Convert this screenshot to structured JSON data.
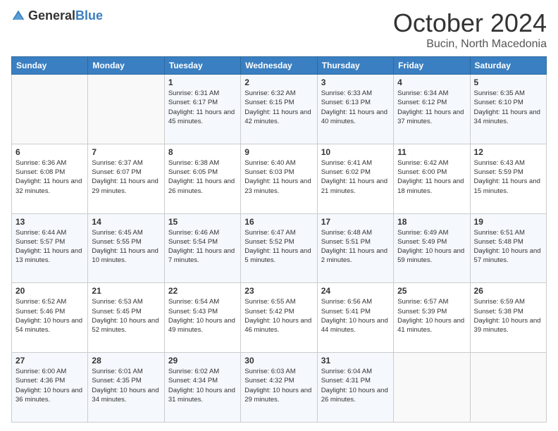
{
  "logo": {
    "general": "General",
    "blue": "Blue"
  },
  "header": {
    "month": "October 2024",
    "location": "Bucin, North Macedonia"
  },
  "weekdays": [
    "Sunday",
    "Monday",
    "Tuesday",
    "Wednesday",
    "Thursday",
    "Friday",
    "Saturday"
  ],
  "weeks": [
    [
      {
        "day": "",
        "sunrise": "",
        "sunset": "",
        "daylight": ""
      },
      {
        "day": "",
        "sunrise": "",
        "sunset": "",
        "daylight": ""
      },
      {
        "day": "1",
        "sunrise": "Sunrise: 6:31 AM",
        "sunset": "Sunset: 6:17 PM",
        "daylight": "Daylight: 11 hours and 45 minutes."
      },
      {
        "day": "2",
        "sunrise": "Sunrise: 6:32 AM",
        "sunset": "Sunset: 6:15 PM",
        "daylight": "Daylight: 11 hours and 42 minutes."
      },
      {
        "day": "3",
        "sunrise": "Sunrise: 6:33 AM",
        "sunset": "Sunset: 6:13 PM",
        "daylight": "Daylight: 11 hours and 40 minutes."
      },
      {
        "day": "4",
        "sunrise": "Sunrise: 6:34 AM",
        "sunset": "Sunset: 6:12 PM",
        "daylight": "Daylight: 11 hours and 37 minutes."
      },
      {
        "day": "5",
        "sunrise": "Sunrise: 6:35 AM",
        "sunset": "Sunset: 6:10 PM",
        "daylight": "Daylight: 11 hours and 34 minutes."
      }
    ],
    [
      {
        "day": "6",
        "sunrise": "Sunrise: 6:36 AM",
        "sunset": "Sunset: 6:08 PM",
        "daylight": "Daylight: 11 hours and 32 minutes."
      },
      {
        "day": "7",
        "sunrise": "Sunrise: 6:37 AM",
        "sunset": "Sunset: 6:07 PM",
        "daylight": "Daylight: 11 hours and 29 minutes."
      },
      {
        "day": "8",
        "sunrise": "Sunrise: 6:38 AM",
        "sunset": "Sunset: 6:05 PM",
        "daylight": "Daylight: 11 hours and 26 minutes."
      },
      {
        "day": "9",
        "sunrise": "Sunrise: 6:40 AM",
        "sunset": "Sunset: 6:03 PM",
        "daylight": "Daylight: 11 hours and 23 minutes."
      },
      {
        "day": "10",
        "sunrise": "Sunrise: 6:41 AM",
        "sunset": "Sunset: 6:02 PM",
        "daylight": "Daylight: 11 hours and 21 minutes."
      },
      {
        "day": "11",
        "sunrise": "Sunrise: 6:42 AM",
        "sunset": "Sunset: 6:00 PM",
        "daylight": "Daylight: 11 hours and 18 minutes."
      },
      {
        "day": "12",
        "sunrise": "Sunrise: 6:43 AM",
        "sunset": "Sunset: 5:59 PM",
        "daylight": "Daylight: 11 hours and 15 minutes."
      }
    ],
    [
      {
        "day": "13",
        "sunrise": "Sunrise: 6:44 AM",
        "sunset": "Sunset: 5:57 PM",
        "daylight": "Daylight: 11 hours and 13 minutes."
      },
      {
        "day": "14",
        "sunrise": "Sunrise: 6:45 AM",
        "sunset": "Sunset: 5:55 PM",
        "daylight": "Daylight: 11 hours and 10 minutes."
      },
      {
        "day": "15",
        "sunrise": "Sunrise: 6:46 AM",
        "sunset": "Sunset: 5:54 PM",
        "daylight": "Daylight: 11 hours and 7 minutes."
      },
      {
        "day": "16",
        "sunrise": "Sunrise: 6:47 AM",
        "sunset": "Sunset: 5:52 PM",
        "daylight": "Daylight: 11 hours and 5 minutes."
      },
      {
        "day": "17",
        "sunrise": "Sunrise: 6:48 AM",
        "sunset": "Sunset: 5:51 PM",
        "daylight": "Daylight: 11 hours and 2 minutes."
      },
      {
        "day": "18",
        "sunrise": "Sunrise: 6:49 AM",
        "sunset": "Sunset: 5:49 PM",
        "daylight": "Daylight: 10 hours and 59 minutes."
      },
      {
        "day": "19",
        "sunrise": "Sunrise: 6:51 AM",
        "sunset": "Sunset: 5:48 PM",
        "daylight": "Daylight: 10 hours and 57 minutes."
      }
    ],
    [
      {
        "day": "20",
        "sunrise": "Sunrise: 6:52 AM",
        "sunset": "Sunset: 5:46 PM",
        "daylight": "Daylight: 10 hours and 54 minutes."
      },
      {
        "day": "21",
        "sunrise": "Sunrise: 6:53 AM",
        "sunset": "Sunset: 5:45 PM",
        "daylight": "Daylight: 10 hours and 52 minutes."
      },
      {
        "day": "22",
        "sunrise": "Sunrise: 6:54 AM",
        "sunset": "Sunset: 5:43 PM",
        "daylight": "Daylight: 10 hours and 49 minutes."
      },
      {
        "day": "23",
        "sunrise": "Sunrise: 6:55 AM",
        "sunset": "Sunset: 5:42 PM",
        "daylight": "Daylight: 10 hours and 46 minutes."
      },
      {
        "day": "24",
        "sunrise": "Sunrise: 6:56 AM",
        "sunset": "Sunset: 5:41 PM",
        "daylight": "Daylight: 10 hours and 44 minutes."
      },
      {
        "day": "25",
        "sunrise": "Sunrise: 6:57 AM",
        "sunset": "Sunset: 5:39 PM",
        "daylight": "Daylight: 10 hours and 41 minutes."
      },
      {
        "day": "26",
        "sunrise": "Sunrise: 6:59 AM",
        "sunset": "Sunset: 5:38 PM",
        "daylight": "Daylight: 10 hours and 39 minutes."
      }
    ],
    [
      {
        "day": "27",
        "sunrise": "Sunrise: 6:00 AM",
        "sunset": "Sunset: 4:36 PM",
        "daylight": "Daylight: 10 hours and 36 minutes."
      },
      {
        "day": "28",
        "sunrise": "Sunrise: 6:01 AM",
        "sunset": "Sunset: 4:35 PM",
        "daylight": "Daylight: 10 hours and 34 minutes."
      },
      {
        "day": "29",
        "sunrise": "Sunrise: 6:02 AM",
        "sunset": "Sunset: 4:34 PM",
        "daylight": "Daylight: 10 hours and 31 minutes."
      },
      {
        "day": "30",
        "sunrise": "Sunrise: 6:03 AM",
        "sunset": "Sunset: 4:32 PM",
        "daylight": "Daylight: 10 hours and 29 minutes."
      },
      {
        "day": "31",
        "sunrise": "Sunrise: 6:04 AM",
        "sunset": "Sunset: 4:31 PM",
        "daylight": "Daylight: 10 hours and 26 minutes."
      },
      {
        "day": "",
        "sunrise": "",
        "sunset": "",
        "daylight": ""
      },
      {
        "day": "",
        "sunrise": "",
        "sunset": "",
        "daylight": ""
      }
    ]
  ]
}
